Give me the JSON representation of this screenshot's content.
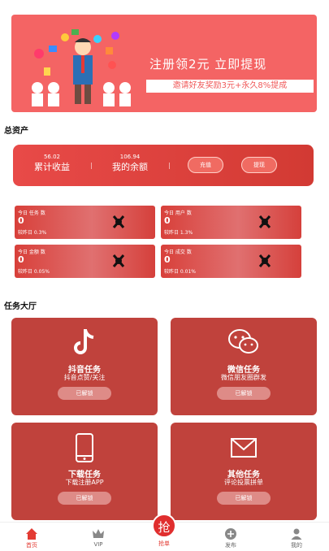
{
  "banner": {
    "title": "注册领2元 立即提现",
    "subtitle": "邀请好友奖励3元+永久8%提成"
  },
  "assets": {
    "section_title": "总资产",
    "earnings_value": "56.02",
    "earnings_label": "累计收益",
    "balance_value": "106.94",
    "balance_label": "我的余额",
    "recharge_label": "充值",
    "withdraw_label": "提现"
  },
  "stats": [
    {
      "title": "今日 任务 数",
      "value": "0",
      "yesterday": "较昨日 0.3%"
    },
    {
      "title": "今日 用户 数",
      "value": "0",
      "yesterday": "较昨日 1.3%"
    },
    {
      "title": "今日 金额 数",
      "value": "0",
      "yesterday": "较昨日 0.05%"
    },
    {
      "title": "今日 成交 数",
      "value": "0",
      "yesterday": "较昨日 0.01%"
    }
  ],
  "tasks": {
    "section_title": "任务大厅",
    "items": [
      {
        "name": "抖音任务",
        "desc": "抖音点赞/关注",
        "button": "已解锁",
        "icon": "tiktok-icon"
      },
      {
        "name": "微信任务",
        "desc": "微信朋友圈群发",
        "button": "已解锁",
        "icon": "wechat-icon"
      },
      {
        "name": "下载任务",
        "desc": "下载注册APP",
        "button": "已解锁",
        "icon": "phone-icon"
      },
      {
        "name": "其他任务",
        "desc": "评论投票拼单",
        "button": "已解锁",
        "icon": "mail-icon"
      }
    ]
  },
  "nav": {
    "home": "首页",
    "vip": "VIP",
    "grab_icon": "抢",
    "grab": "抢单",
    "publish": "发布",
    "mine": "我的"
  },
  "colors": {
    "primary": "#e33b33",
    "banner": "#f46464",
    "card": "#c0423c"
  }
}
